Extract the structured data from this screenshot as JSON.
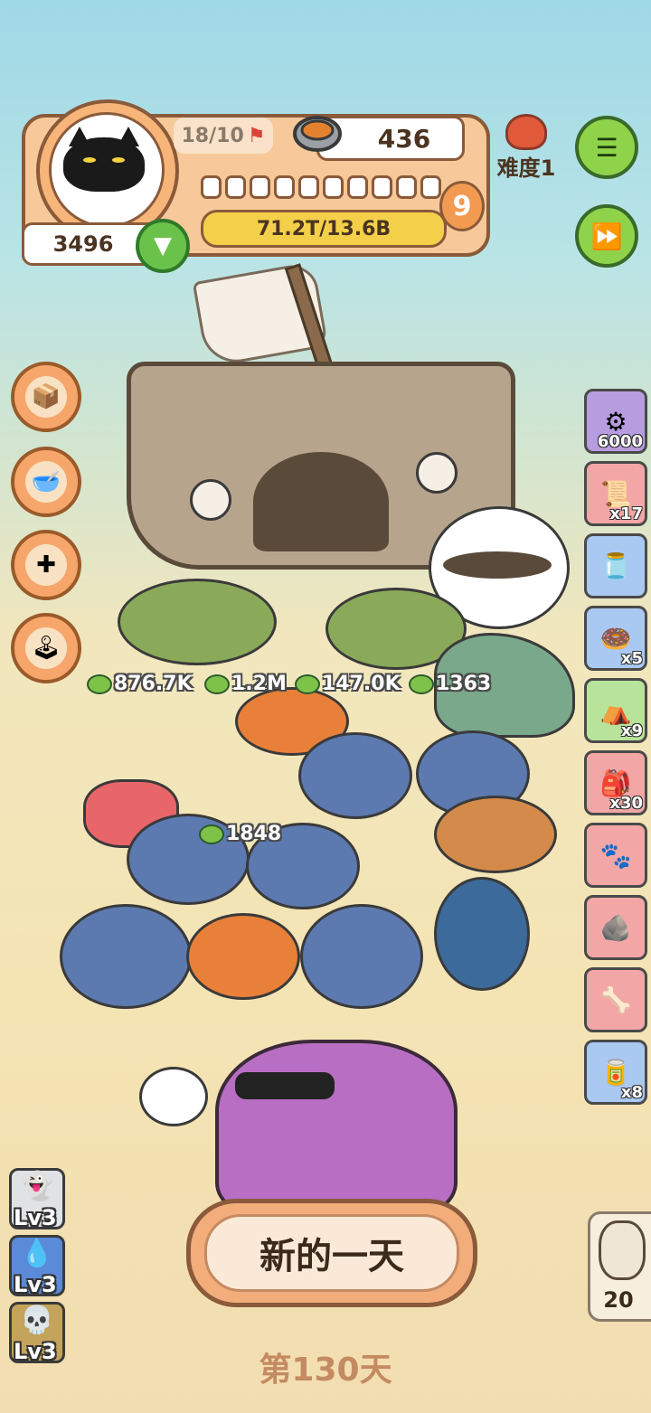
{
  "hud": {
    "flags": "18/10",
    "coins": "436",
    "level": "9",
    "xp": "71.2T/13.6B",
    "score": "3496",
    "difficulty": "难度1"
  },
  "side_menu": [
    {
      "name": "box-icon"
    },
    {
      "name": "bowl-icon"
    },
    {
      "name": "medkit-icon"
    },
    {
      "name": "joystick-icon"
    }
  ],
  "inventory": [
    {
      "name": "item-shell-pot",
      "count": "6000",
      "bg": "#b79ce0"
    },
    {
      "name": "item-scroll-key",
      "count": "x17",
      "bg": "#f3a6a6"
    },
    {
      "name": "item-jar",
      "count": "",
      "bg": "#a9c8f2"
    },
    {
      "name": "item-donut",
      "count": "x5",
      "bg": "#a9c8f2"
    },
    {
      "name": "item-tent",
      "count": "x9",
      "bg": "#b7e39a"
    },
    {
      "name": "item-bag",
      "count": "x30",
      "bg": "#f3a6a6"
    },
    {
      "name": "item-paw-plus2",
      "count": "",
      "bg": "#f3a6a6"
    },
    {
      "name": "item-green-rock",
      "count": "",
      "bg": "#f3a6a6"
    },
    {
      "name": "item-skeleton",
      "count": "",
      "bg": "#f3a6a6"
    },
    {
      "name": "item-tin",
      "count": "x8",
      "bg": "#a9c8f2"
    }
  ],
  "damage_numbers": [
    "876.7K",
    "1.2M",
    "147.0K",
    "1363",
    "1848"
  ],
  "perks": [
    {
      "label": "Lv3"
    },
    {
      "label": "Lv3"
    },
    {
      "label": "Lv3"
    }
  ],
  "new_day_button": "新的一天",
  "day": "第130天",
  "owl_count": "20",
  "colors": {
    "accent": "#f7c99a",
    "green": "#8fd34a",
    "border": "#8a5a3a"
  }
}
